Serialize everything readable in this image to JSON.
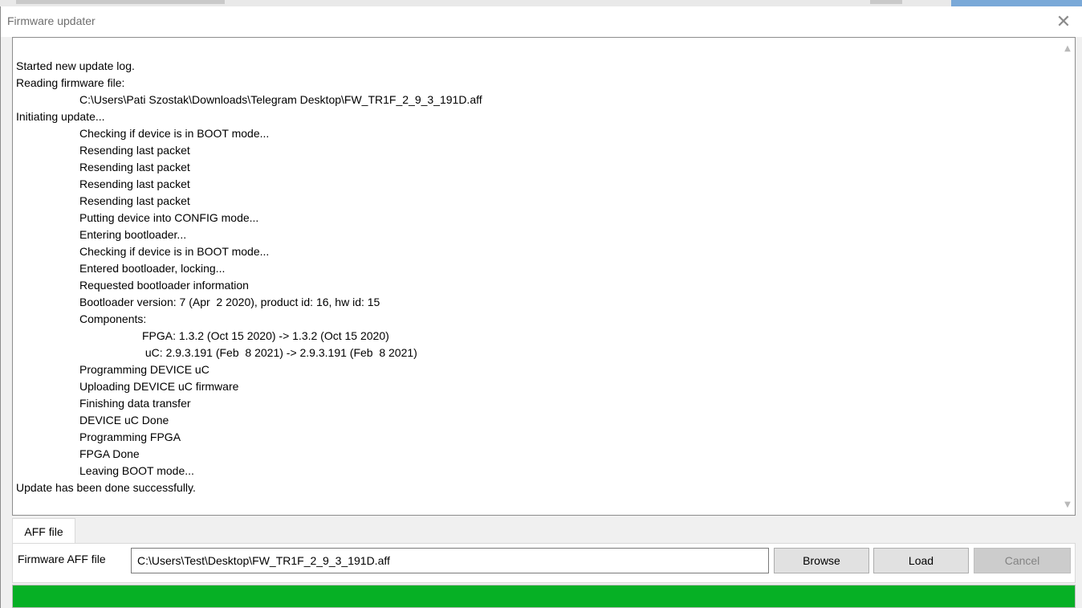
{
  "window": {
    "title": "Firmware updater",
    "close_icon": "close-icon"
  },
  "log": {
    "lines": [
      {
        "indent": 0,
        "text": "Started new update log."
      },
      {
        "indent": 0,
        "text": "Reading firmware file:"
      },
      {
        "indent": 1,
        "text": "C:\\Users\\Pati Szostak\\Downloads\\Telegram Desktop\\FW_TR1F_2_9_3_191D.aff"
      },
      {
        "indent": 0,
        "text": "Initiating update..."
      },
      {
        "indent": 1,
        "text": "Checking if device is in BOOT mode..."
      },
      {
        "indent": 1,
        "text": "Resending last packet"
      },
      {
        "indent": 1,
        "text": "Resending last packet"
      },
      {
        "indent": 1,
        "text": "Resending last packet"
      },
      {
        "indent": 1,
        "text": "Resending last packet"
      },
      {
        "indent": 1,
        "text": "Putting device into CONFIG mode..."
      },
      {
        "indent": 1,
        "text": "Entering bootloader..."
      },
      {
        "indent": 1,
        "text": "Checking if device is in BOOT mode..."
      },
      {
        "indent": 1,
        "text": "Entered bootloader, locking..."
      },
      {
        "indent": 1,
        "text": "Requested bootloader information"
      },
      {
        "indent": 1,
        "text": "Bootloader version: 7 (Apr  2 2020), product id: 16, hw id: 15"
      },
      {
        "indent": 1,
        "text": "Components:"
      },
      {
        "indent": 2,
        "text": "FPGA: 1.3.2 (Oct 15 2020) -> 1.3.2 (Oct 15 2020)"
      },
      {
        "indent": 2,
        "text": " uC: 2.9.3.191 (Feb  8 2021) -> 2.9.3.191 (Feb  8 2021)"
      },
      {
        "indent": 1,
        "text": "Programming DEVICE uC"
      },
      {
        "indent": 1,
        "text": "Uploading DEVICE uC firmware"
      },
      {
        "indent": 1,
        "text": "Finishing data transfer"
      },
      {
        "indent": 1,
        "text": "DEVICE uC Done"
      },
      {
        "indent": 1,
        "text": "Programming FPGA"
      },
      {
        "indent": 1,
        "text": "FPGA Done"
      },
      {
        "indent": 1,
        "text": "Leaving BOOT mode..."
      },
      {
        "indent": 0,
        "text": "Update has been done successfully."
      }
    ]
  },
  "tabs": [
    {
      "label": "AFF file"
    }
  ],
  "aff_panel": {
    "label": "Firmware AFF file",
    "path_value": "C:\\Users\\Test\\Desktop\\FW_TR1F_2_9_3_191D.aff",
    "browse_label": "Browse",
    "load_label": "Load",
    "cancel_label": "Cancel"
  },
  "progress": {
    "percent": 100,
    "color": "#06b025"
  }
}
